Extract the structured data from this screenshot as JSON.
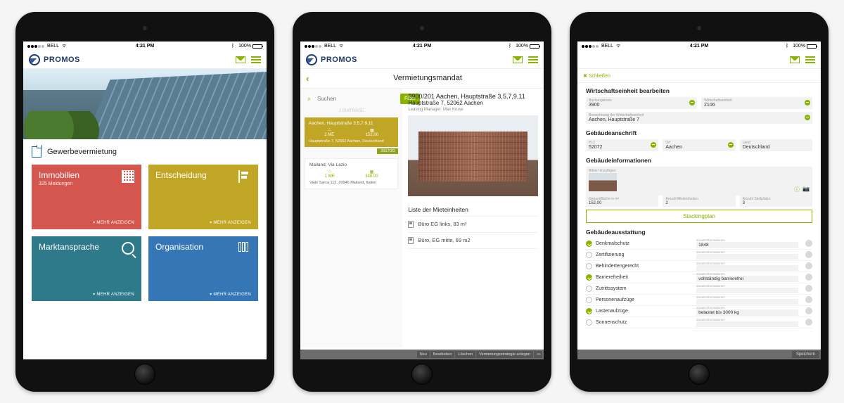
{
  "status": {
    "carrier": "BELL",
    "time": "4:21 PM",
    "battery": "100%"
  },
  "brand": "PROMOS",
  "screen1": {
    "section": "Gewerbevermietung",
    "tiles": [
      {
        "title": "Immobilien",
        "sub": "325 Meldungen",
        "more": "MEHR ANZEIGEN"
      },
      {
        "title": "Entscheidung",
        "sub": "",
        "more": "MEHR ANZEIGEN"
      },
      {
        "title": "Marktansprache",
        "sub": "",
        "more": "MEHR ANZEIGEN"
      },
      {
        "title": "Organisation",
        "sub": "",
        "more": "MEHR ANZEIGEN"
      }
    ]
  },
  "screen2": {
    "title": "Vermietungsmandat",
    "search": "Suchen",
    "filter": "Filter",
    "hint": "2 EINTRÄGE",
    "cards": [
      {
        "addr": "Aachen, Hauptstraße 3,5,7,9,11",
        "c1l": "2 ME",
        "c2l": "152,00",
        "foot": "Hauptstraße 7, 52062 Aachen, Deutschland",
        "tag": "2017/20"
      },
      {
        "addr": "Mailand, Via Lazio",
        "c1l": "1 ME",
        "c2l": "348,00",
        "foot": "Viale Sarca 112, 20946 Mailand, Italien"
      }
    ],
    "object": {
      "l1": "3900/201 Aachen, Hauptstraße 3,5,7,9,11",
      "l2": "Hauptstraße 7, 52062 Aachen",
      "mgr": "Leasing Manager: Max Kruse"
    },
    "list_title": "Liste der Mieteinheiten",
    "units": [
      "Büro EG links, 83 m²",
      "Büro, EG mitte, 69 m2"
    ],
    "footer": [
      "Neu",
      "Bearbeiten",
      "Löschen",
      "Vermietungsstrategie anlegen",
      "•••"
    ]
  },
  "screen3": {
    "close": "Schließen",
    "sec1": {
      "h": "Wirtschaftseinheit bearbeiten",
      "f1l": "Buchungskreis",
      "f1v": "3900",
      "f2l": "Wirtschaftseinheit",
      "f2v": "2106",
      "f3l": "Bezeichnung der Wirtschaftseinheit",
      "f3v": "Aachen, Hauptstraße 7"
    },
    "sec2": {
      "h": "Gebäudeanschrift",
      "f1l": "PLZ",
      "f1v": "52072",
      "f2l": "Ort",
      "f2v": "Aachen",
      "f3l": "Land",
      "f3v": "Deutschland"
    },
    "sec3": {
      "h": "Gebäudeinformationen",
      "addimg": "Bilder hinzufügen",
      "f1l": "Gesamtfläche in m²",
      "f1v": "152,00",
      "f2l": "Anzahl Mieteinheiten",
      "f2v": "2",
      "f3l": "Anzahl Stellplätze",
      "f3v": "3",
      "btn": "Stackingplan"
    },
    "sec4": {
      "h": "Gebäudeausstattung",
      "rows": [
        {
          "on": true,
          "label": "Denkmalschutz",
          "ext": "1848"
        },
        {
          "on": false,
          "label": "Zertifizierung",
          "ext": ""
        },
        {
          "on": false,
          "label": "Behindertengerecht",
          "ext": ""
        },
        {
          "on": true,
          "label": "Barrierefreiheit",
          "ext": "vollständig barrierefrei"
        },
        {
          "on": false,
          "label": "Zutrittssystem",
          "ext": ""
        },
        {
          "on": false,
          "label": "Personenaufzüge",
          "ext": ""
        },
        {
          "on": true,
          "label": "Lastenaufzüge",
          "ext": "belastet bis 3000 kg"
        },
        {
          "on": false,
          "label": "Sonnenschutz",
          "ext": ""
        }
      ],
      "ext_label": "Zusatzinformationen"
    },
    "save": "Speichern"
  }
}
